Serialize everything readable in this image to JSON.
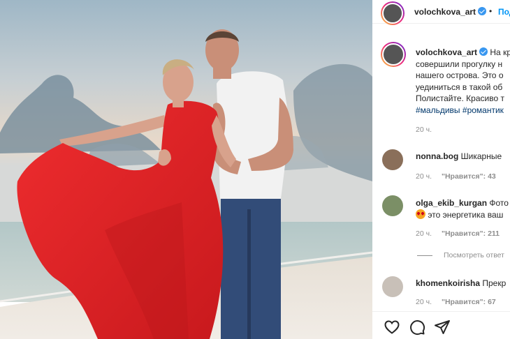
{
  "post": {
    "author": "volochkova_art",
    "follow_label": "Под",
    "dot": "•"
  },
  "caption": {
    "username": "volochkova_art",
    "lines": [
      "На кр",
      "совершили прогулку н",
      "нашего острова. Это о",
      "уединиться в такой об",
      "Полистайте. Красиво т",
      "#мальдивы #романтик"
    ],
    "time": "20 ч."
  },
  "comments": [
    {
      "username": "nonna.bog",
      "text": "Шикарные",
      "time": "20 ч.",
      "likes": "\"Нравится\": 43"
    },
    {
      "username": "olga_ekib_kurgan",
      "text": "Фото",
      "text2": "это энергетика ваш",
      "time": "20 ч.",
      "likes": "\"Нравится\": 211"
    },
    {
      "username": "khomenkoirisha",
      "text": "Прекр",
      "time": "20 ч.",
      "likes": "\"Нравится\": 67"
    }
  ],
  "view_replies": "Посмотреть ответ",
  "icons": {
    "like": "heart-icon",
    "comment": "comment-icon",
    "share": "share-icon",
    "verified": "verified-badge-icon"
  },
  "colors": {
    "link_blue": "#0095f6",
    "hashtag": "#00376b",
    "muted": "#8e8e8e",
    "verified": "#3897f0",
    "dress_red": "#e02527"
  }
}
